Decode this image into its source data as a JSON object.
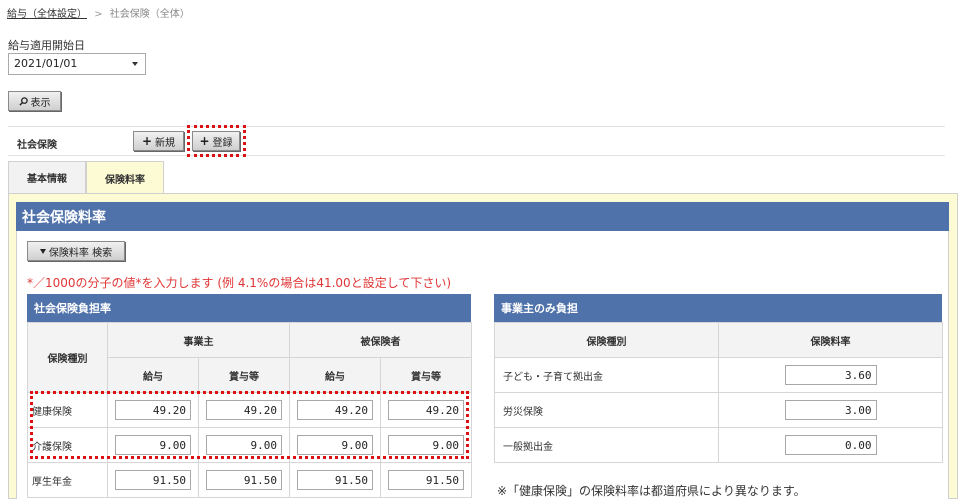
{
  "breadcrumb": {
    "parent": "給与（全体設定）",
    "separator": ">",
    "current": "社会保険（全体）"
  },
  "filter": {
    "date_label": "給与適用開始日",
    "date_value": "2021/01/01",
    "show_button": "表示"
  },
  "section": {
    "label": "社会保険",
    "new_button": "新規",
    "register_button": "登録"
  },
  "tabs": [
    {
      "label": "基本情報",
      "active": false
    },
    {
      "label": "保険料率",
      "active": true
    }
  ],
  "panel": {
    "title": "社会保険料率",
    "search_toggle": "保険料率 検索",
    "note": "*／1000の分子の値*を入力します (例 4.1%の場合は41.00と設定して下さい)",
    "footer_note": "※「健康保険」の保険料率は都道府県により異なります。"
  },
  "burden_table": {
    "title": "社会保険負担率",
    "col_type": "保険種別",
    "group_employer": "事業主",
    "group_employee": "被保険者",
    "col_salary": "給与",
    "col_bonus": "賞与等",
    "rows": [
      {
        "label": "健康保険",
        "values": [
          "49.20",
          "49.20",
          "49.20",
          "49.20"
        ]
      },
      {
        "label": "介護保険",
        "values": [
          "9.00",
          "9.00",
          "9.00",
          "9.00"
        ]
      },
      {
        "label": "厚生年金",
        "values": [
          "91.50",
          "91.50",
          "91.50",
          "91.50"
        ]
      }
    ]
  },
  "employer_table": {
    "title": "事業主のみ負担",
    "col_type": "保険種別",
    "col_rate": "保険料率",
    "rows": [
      {
        "label": "子ども・子育て拠出金",
        "value": "3.60"
      },
      {
        "label": "労災保険",
        "value": "3.00"
      },
      {
        "label": "一般拠出金",
        "value": "0.00"
      }
    ]
  },
  "colors": {
    "header_blue": "#5072ab",
    "tab_active_bg": "#fdfbd4",
    "note_red": "#e03535",
    "highlight_red": "#dd1111"
  },
  "icons": {
    "show_button": "search-icon",
    "new_button": "plus-icon",
    "register_button": "plus-icon",
    "search_toggle": "triangle-down-icon",
    "date_select": "chevron-down-icon"
  }
}
